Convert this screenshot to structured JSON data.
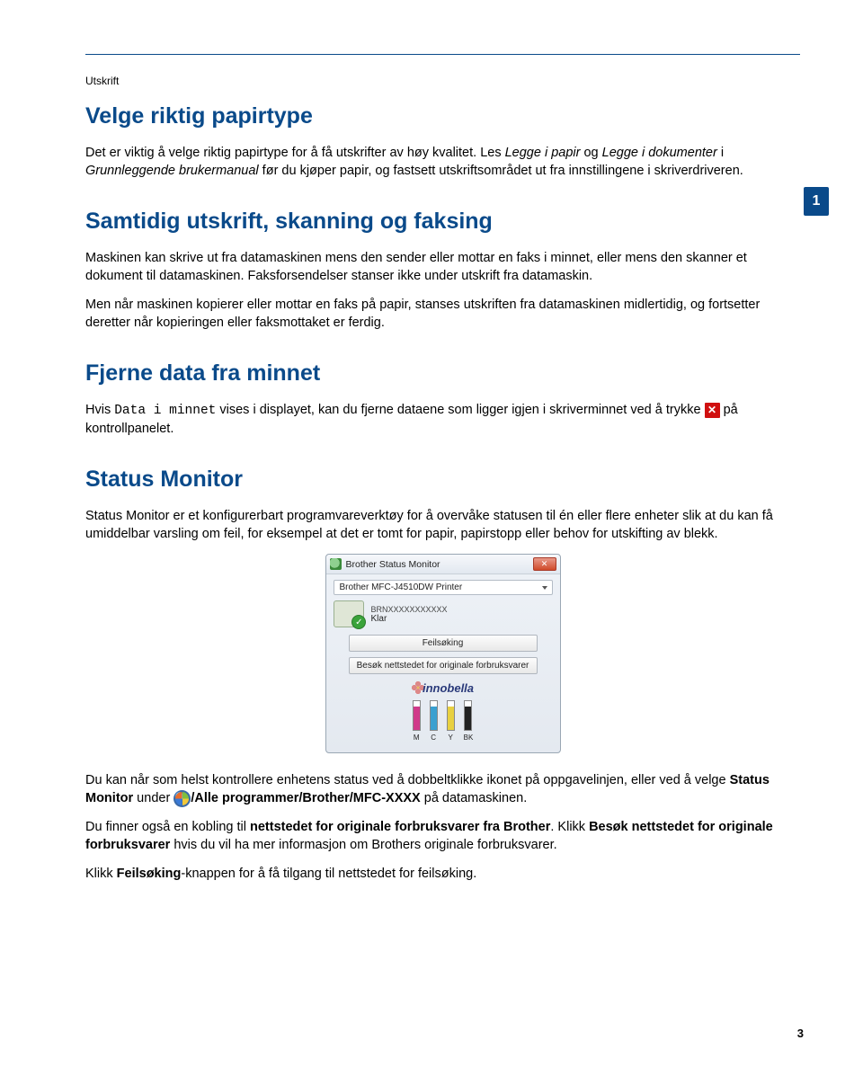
{
  "section_label": "Utskrift",
  "page_marker": "1",
  "page_number": "3",
  "h1": "Velge riktig papirtype",
  "p1_a": "Det er viktig å velge riktig papirtype for å få utskrifter av høy kvalitet. Les ",
  "p1_i1": "Legge i papir",
  "p1_b": " og ",
  "p1_i2": "Legge i dokumenter",
  "p1_c": " i ",
  "p1_i3": "Grunnleggende brukermanual",
  "p1_d": " før du kjøper papir, og fastsett utskriftsområdet ut fra innstillingene i skriverdriveren.",
  "h2a": "Samtidig utskrift, skanning og faksing",
  "p2": "Maskinen kan skrive ut fra datamaskinen mens den sender eller mottar en faks i minnet, eller mens den skanner et dokument til datamaskinen. Faksforsendelser stanser ikke under utskrift fra datamaskin.",
  "p3": "Men når maskinen kopierer eller mottar en faks på papir, stanses utskriften fra datamaskinen midlertidig, og fortsetter deretter når kopieringen eller faksmottaket er ferdig.",
  "h2b": "Fjerne data fra minnet",
  "p4_a": "Hvis ",
  "p4_mono": "Data i minnet",
  "p4_b": " vises i displayet, kan du fjerne dataene som ligger igjen i skriverminnet ved å trykke ",
  "p4_c": " på kontrollpanelet.",
  "h2c": "Status Monitor",
  "p5": "Status Monitor er et konfigurerbart programvareverktøy for å overvåke statusen til én eller flere enheter slik at du kan få umiddelbar varsling om feil, for eksempel at det er tomt for papir, papirstopp eller behov for utskifting av blekk.",
  "sm": {
    "title": "Brother Status Monitor",
    "printer": "Brother MFC-J4510DW Printer",
    "serial": "BRNXXXXXXXXXXX",
    "status": "Klar",
    "btn1": "Feilsøking",
    "btn2": "Besøk nettstedet for originale forbruksvarer",
    "logo": "innobella",
    "ink": {
      "m": "M",
      "c": "C",
      "y": "Y",
      "bk": "BK"
    }
  },
  "p6_a": "Du kan når som helst kontrollere enhetens status ved å dobbeltklikke ikonet på oppgavelinjen, eller ved å velge ",
  "p6_bold1": "Status Monitor",
  "p6_b": " under ",
  "p6_bold2": "/Alle programmer/Brother/MFC-XXXX",
  "p6_c": " på datamaskinen.",
  "p7_a": "Du finner også en kobling til ",
  "p7_bold1": "nettstedet for originale forbruksvarer fra Brother",
  "p7_b": ". Klikk ",
  "p7_bold2": "Besøk nettstedet for originale forbruksvarer",
  "p7_c": " hvis du vil ha mer informasjon om Brothers originale forbruksvarer.",
  "p8_a": "Klikk ",
  "p8_bold": "Feilsøking",
  "p8_b": "-knappen for å få tilgang til nettstedet for feilsøking."
}
